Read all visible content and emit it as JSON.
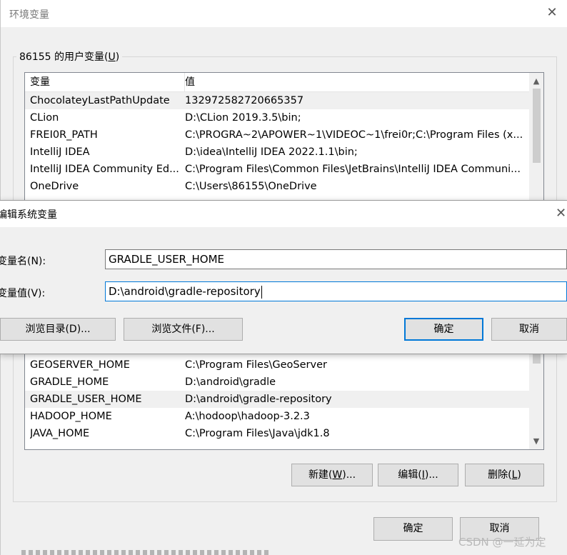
{
  "outer": {
    "title": "环境变量",
    "user_group": {
      "label_prefix": "86155 的用户变量(",
      "label_key": "U",
      "label_suffix": ")"
    },
    "columns": [
      "变量",
      "值"
    ],
    "rows_top": [
      {
        "name": "ChocolateyLastPathUpdate",
        "value": "132972582720665357",
        "selected": true
      },
      {
        "name": "CLion",
        "value": "D:\\CLion 2019.3.5\\bin;"
      },
      {
        "name": "FREI0R_PATH",
        "value": "C:\\PROGRA~2\\APOWER~1\\VIDEOC~1\\frei0r;C:\\Program Files (x..."
      },
      {
        "name": "IntelliJ IDEA",
        "value": "D:\\idea\\IntelliJ IDEA 2022.1.1\\bin;"
      },
      {
        "name": "IntelliJ IDEA Community Ed...",
        "value": "C:\\Program Files\\Common Files\\JetBrains\\IntelliJ IDEA Communi..."
      },
      {
        "name": "OneDrive",
        "value": "C:\\Users\\86155\\OneDrive"
      }
    ],
    "rows_bottom": [
      {
        "name": "GEOSERVER_HOME",
        "value": "C:\\Program Files\\GeoServer"
      },
      {
        "name": "GRADLE_HOME",
        "value": "D:\\android\\gradle"
      },
      {
        "name": "GRADLE_USER_HOME",
        "value": "D:\\android\\gradle-repository",
        "selected": true
      },
      {
        "name": "HADOOP_HOME",
        "value": "A:\\hodoop\\hadoop-3.2.3"
      },
      {
        "name": "JAVA_HOME",
        "value": "C:\\Program Files\\Java\\jdk1.8"
      }
    ],
    "buttons": {
      "new": {
        "prefix": "新建(",
        "key": "W",
        "suffix": ")..."
      },
      "edit": {
        "prefix": "编辑(",
        "key": "I",
        "suffix": ")..."
      },
      "delete": {
        "prefix": "删除(",
        "key": "L",
        "suffix": ")"
      },
      "ok": "确定",
      "cancel": "取消"
    }
  },
  "edit_dialog": {
    "title": "编辑系统变量",
    "name_label": "变量名(N):",
    "name_value": "GRADLE_USER_HOME",
    "value_label": "变量值(V):",
    "value_value": "D:\\android\\gradle-repository",
    "browse_dir": "浏览目录(D)...",
    "browse_file": "浏览文件(F)...",
    "ok": "确定",
    "cancel": "取消"
  },
  "watermark": "CSDN @一延为定",
  "colors": {
    "accent": "#0078d7",
    "selected_row": "#f0f0f0"
  }
}
